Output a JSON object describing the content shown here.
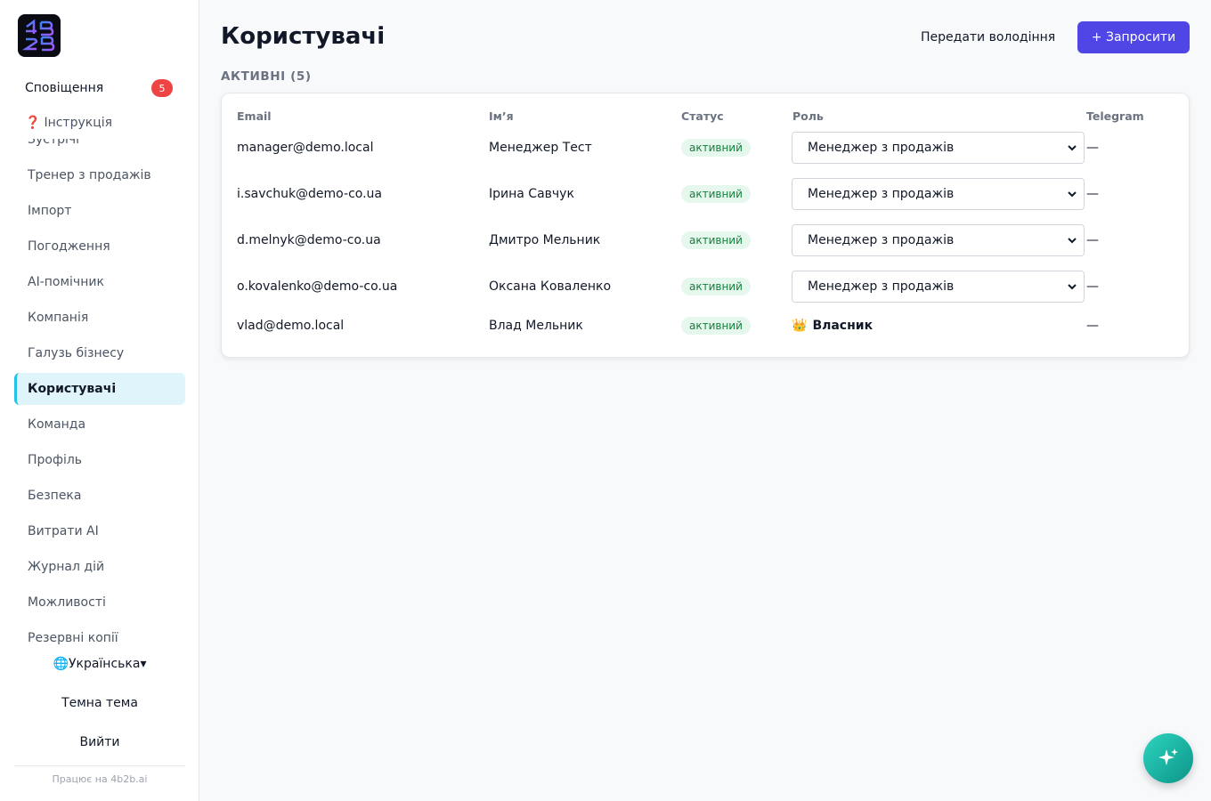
{
  "sidebar": {
    "logo_text": "4B2B",
    "notifications": {
      "label": "Сповіщення",
      "count": "5"
    },
    "guide": {
      "icon": "question-icon",
      "glyph": "❓",
      "label": "Інструкція"
    },
    "items": [
      {
        "label": "Зустрічі"
      },
      {
        "label": "Тренер з продажів"
      },
      {
        "label": "Імпорт"
      },
      {
        "label": "Погодження"
      },
      {
        "label": "AI-помічник"
      },
      {
        "label": "Компанія"
      },
      {
        "label": "Галузь бізнесу"
      },
      {
        "label": "Користувачі",
        "active": true
      },
      {
        "label": "Команда"
      },
      {
        "label": "Профіль"
      },
      {
        "label": "Безпека"
      },
      {
        "label": "Витрати AI"
      },
      {
        "label": "Журнал дій"
      },
      {
        "label": "Можливості"
      },
      {
        "label": "Резервні копії"
      }
    ],
    "language": {
      "icon": "globe-icon",
      "glyph": "🌐",
      "label": "Українська",
      "caret": "▾"
    },
    "theme_label": "Темна тема",
    "logout_label": "Вийти",
    "powered_by": "Працює на 4b2b.ai"
  },
  "header": {
    "title": "Користувачі",
    "transfer_label": "Передати володіння",
    "invite_label": "+ Запросити"
  },
  "section": {
    "heading": "АКТИВНІ (5)"
  },
  "table": {
    "columns": {
      "email": "Email",
      "name": "Ім’я",
      "status": "Статус",
      "role": "Роль",
      "telegram": "Telegram"
    },
    "rows": [
      {
        "email": "manager@demo.local",
        "name": "Менеджер Тест",
        "status": "активний",
        "role": "Менеджер з продажів",
        "telegram": "—"
      },
      {
        "email": "i.savchuk@demo-co.ua",
        "name": "Ірина Савчук",
        "status": "активний",
        "role": "Менеджер з продажів",
        "telegram": "—"
      },
      {
        "email": "d.melnyk@demo-co.ua",
        "name": "Дмитро Мельник",
        "status": "активний",
        "role": "Менеджер з продажів",
        "telegram": "—"
      },
      {
        "email": "o.kovalenko@demo-co.ua",
        "name": "Оксана Коваленко",
        "status": "активний",
        "role": "Менеджер з продажів",
        "telegram": "—"
      }
    ],
    "owner_row": {
      "email": "vlad@demo.local",
      "name": "Влад Мельник",
      "status": "активний",
      "role_icon": "crown-icon",
      "role_glyph": "👑",
      "role": "Власник",
      "telegram": "—"
    }
  },
  "colors": {
    "accent": "#4f46e5",
    "active_nav": "#e0f4fb",
    "active_nav_border": "#22c3e6",
    "badge": "#ef4444",
    "status_bg": "#e6f7ee",
    "status_text": "#15803d",
    "fab": "#14b8a6"
  },
  "fab": {
    "icon": "sparkles-icon"
  }
}
